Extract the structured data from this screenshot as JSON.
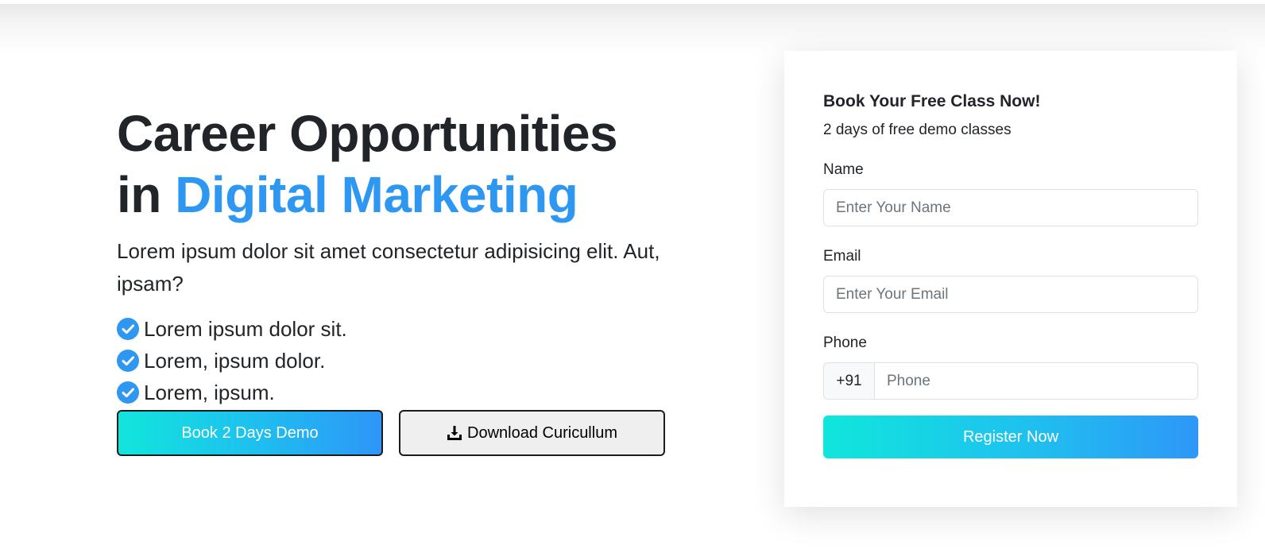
{
  "hero": {
    "title_line1": "Career Opportunities",
    "title_prefix": "in",
    "title_accent": "Digital Marketing",
    "lead": "Lorem ipsum dolor sit amet consectetur adipisicing elit. Aut, ipsam?",
    "features": [
      "Lorem ipsum dolor sit.",
      "Lorem, ipsum dolor.",
      "Lorem, ipsum."
    ],
    "book_button_label": "Book 2 Days Demo",
    "download_button_label": "Download Curicullum"
  },
  "form": {
    "title": "Book Your Free Class Now!",
    "subtitle": "2 days of free demo classes",
    "name_label": "Name",
    "name_placeholder": "Enter Your Name",
    "email_label": "Email",
    "email_placeholder": "Enter Your Email",
    "phone_label": "Phone",
    "phone_prefix": "+91",
    "phone_placeholder": "Phone",
    "submit_label": "Register Now"
  },
  "icons": {
    "check": "check-circle-icon",
    "download": "download-icon"
  },
  "colors": {
    "accent": "#2e97f2",
    "gradient_start": "#12e5dc",
    "gradient_end": "#2e95f7",
    "text": "#212529"
  }
}
